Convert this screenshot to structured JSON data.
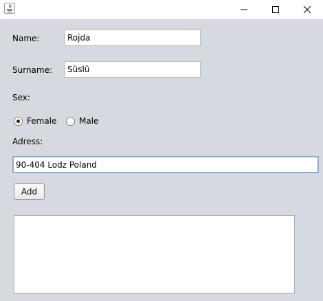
{
  "window": {
    "app_icon": "java-icon",
    "controls": {
      "minimize_icon": "minimize-icon",
      "maximize_icon": "maximize-icon",
      "close_icon": "close-icon"
    }
  },
  "form": {
    "name_label": "Name:",
    "name_value": "Rojda",
    "surname_label": "Surname:",
    "surname_value": "Süslü",
    "sex_label": "Sex:",
    "sex_options": [
      {
        "label": "Female",
        "selected": true
      },
      {
        "label": "Male",
        "selected": false
      }
    ],
    "address_label": "Adress:",
    "address_value": "90-404 Lodz Poland",
    "add_button_label": "Add",
    "output_text": ""
  }
}
